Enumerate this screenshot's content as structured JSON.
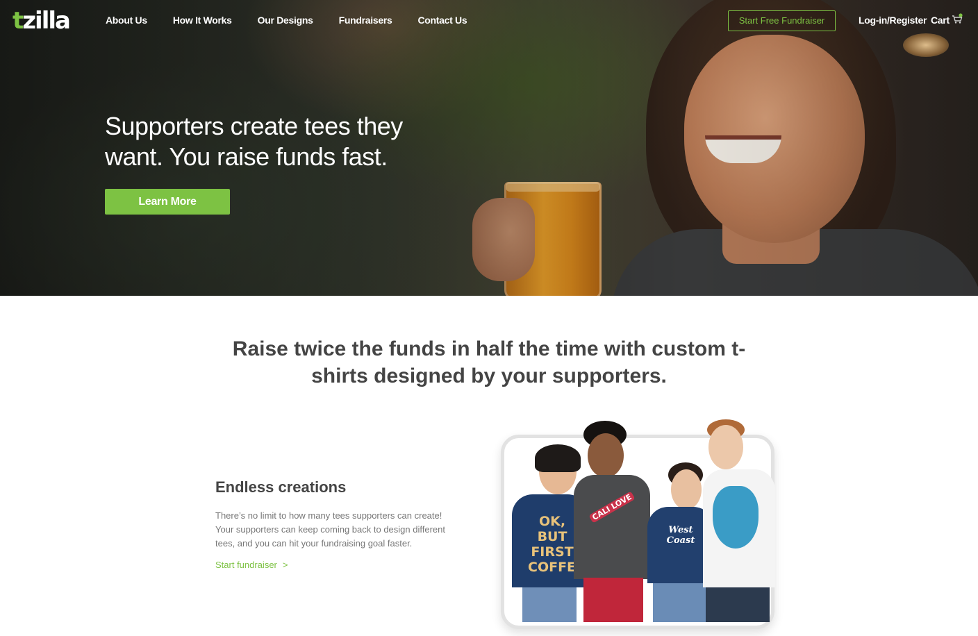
{
  "brand": {
    "logo_text_accent": "t",
    "logo_text_rest": "zilla",
    "accent_color": "#7dc243"
  },
  "nav": {
    "links": [
      "About Us",
      "How It Works",
      "Our Designs",
      "Fundraisers",
      "Contact Us"
    ],
    "cta": "Start Free Fundraiser",
    "login": "Log-in/Register",
    "cart": "Cart",
    "cart_icon": "cart-icon"
  },
  "hero": {
    "title": "Supporters create tees they want. You raise funds fast.",
    "button": "Learn More"
  },
  "section": {
    "tagline": "Raise twice the funds in half the time with custom t-shirts designed by your supporters.",
    "feature": {
      "title": "Endless creations",
      "text": "There’s no limit to how many tees supporters can create! Your supporters can keep coming back to design different tees, and you can hit your fundraising goal faster.",
      "link": "Start fundraiser",
      "link_chevron": ">"
    },
    "photo": {
      "shirt_1": "OK, BUT FIRST COFFEE",
      "shirt_2": "CALI LOVE",
      "shirt_3": "West Coast"
    }
  }
}
